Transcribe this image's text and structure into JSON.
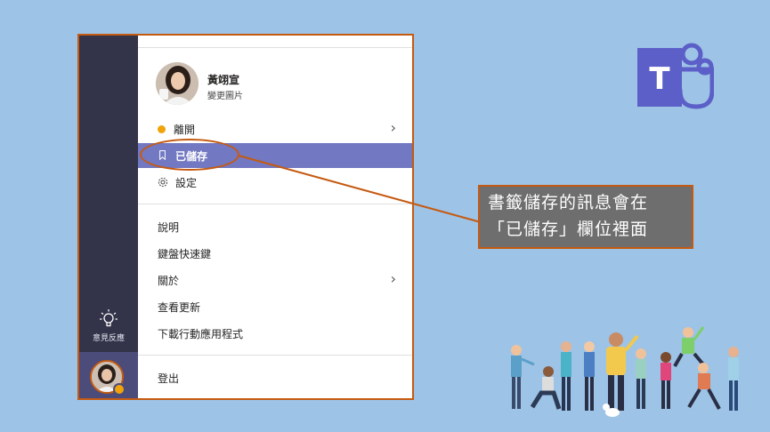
{
  "profile": {
    "name": "黃翊宣",
    "change_picture": "變更圖片"
  },
  "menu": {
    "status_label": "離開",
    "saved_label": "已儲存",
    "settings_label": "設定",
    "help_label": "說明",
    "shortcuts_label": "鍵盤快速鍵",
    "about_label": "關於",
    "whats_new_label": "查看更新",
    "download_label": "下載行動應用程式",
    "signout_label": "登出"
  },
  "rail": {
    "feedback_label": "意見反應"
  },
  "callout": {
    "line1": "書籤儲存的訊息會在",
    "line2": "「已儲存」欄位裡面"
  },
  "colors": {
    "background": "#9dc3e6",
    "rail": "#33344a",
    "highlight": "#7278c2",
    "annotation": "#c55a11",
    "status": "#f0a30a"
  }
}
